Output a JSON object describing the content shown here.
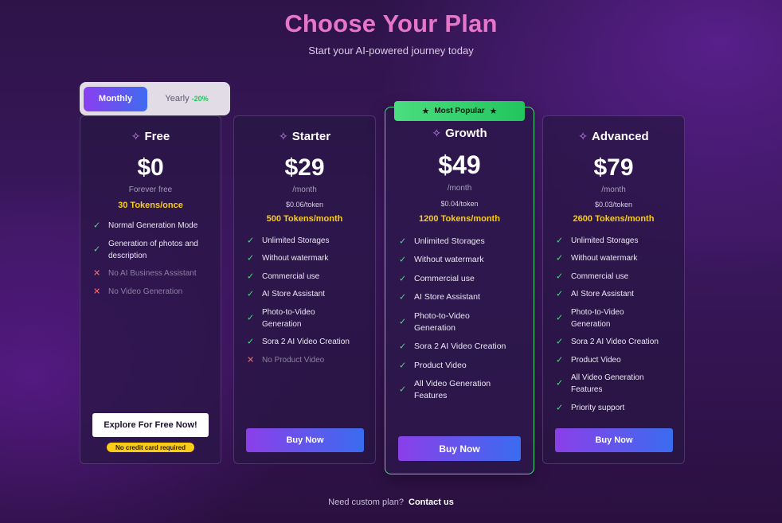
{
  "header": {
    "title": "Choose Your Plan",
    "subtitle": "Start your AI-powered journey today"
  },
  "billing_toggle": {
    "monthly": "Monthly",
    "yearly": "Yearly",
    "yearly_discount": "-20%",
    "selected": "Monthly"
  },
  "plans": [
    {
      "name": "Free",
      "price": "$0",
      "price_note": "Forever free",
      "tokens": "30 Tokens/once",
      "features": [
        {
          "text": "Normal Generation Mode",
          "included": true
        },
        {
          "text": "Generation of photos and description",
          "included": true
        },
        {
          "text": "No AI Business Assistant",
          "included": false
        },
        {
          "text": "No Video Generation",
          "included": false
        }
      ],
      "cta": "Explore For Free Now!",
      "cta_note": "No credit card required"
    },
    {
      "name": "Starter",
      "price": "$29",
      "price_note": "/month",
      "per_token": "$0.06/token",
      "tokens": "500 Tokens/month",
      "features": [
        {
          "text": "Unlimited Storages",
          "included": true
        },
        {
          "text": "Without watermark",
          "included": true
        },
        {
          "text": "Commercial use",
          "included": true
        },
        {
          "text": "AI Store Assistant",
          "included": true
        },
        {
          "text": "Photo-to-Video Generation",
          "included": true
        },
        {
          "text": "Sora 2 AI Video Creation",
          "included": true
        },
        {
          "text": "No Product Video",
          "included": false
        }
      ],
      "cta": "Buy Now"
    },
    {
      "name": "Growth",
      "badge": "Most Popular",
      "price": "$49",
      "price_note": "/month",
      "per_token": "$0.04/token",
      "tokens": "1200 Tokens/month",
      "features": [
        {
          "text": "Unlimited Storages",
          "included": true
        },
        {
          "text": "Without watermark",
          "included": true
        },
        {
          "text": "Commercial use",
          "included": true
        },
        {
          "text": "AI Store Assistant",
          "included": true
        },
        {
          "text": "Photo-to-Video Generation",
          "included": true
        },
        {
          "text": "Sora 2 AI Video Creation",
          "included": true
        },
        {
          "text": "Product Video",
          "included": true
        },
        {
          "text": "All Video Generation Features",
          "included": true
        }
      ],
      "cta": "Buy Now"
    },
    {
      "name": "Advanced",
      "price": "$79",
      "price_note": "/month",
      "per_token": "$0.03/token",
      "tokens": "2600 Tokens/month",
      "features": [
        {
          "text": "Unlimited Storages",
          "included": true
        },
        {
          "text": "Without watermark",
          "included": true
        },
        {
          "text": "Commercial use",
          "included": true
        },
        {
          "text": "AI Store Assistant",
          "included": true
        },
        {
          "text": "Photo-to-Video Generation",
          "included": true
        },
        {
          "text": "Sora 2 AI Video Creation",
          "included": true
        },
        {
          "text": "Product Video",
          "included": true
        },
        {
          "text": "All Video Generation Features",
          "included": true
        },
        {
          "text": "Priority support",
          "included": true
        }
      ],
      "cta": "Buy Now"
    }
  ],
  "footer": {
    "prompt": "Need custom plan?",
    "link": "Contact us"
  },
  "colors": {
    "title": "#e776c8",
    "tokens": "#facc15",
    "check": "#4ade80",
    "cross": "#f87171",
    "popular_border": "#4ade80"
  },
  "icons": {
    "plan_icon": "sparkle-icon",
    "included": "check-icon",
    "excluded": "x-icon",
    "badge": "star-icon"
  }
}
